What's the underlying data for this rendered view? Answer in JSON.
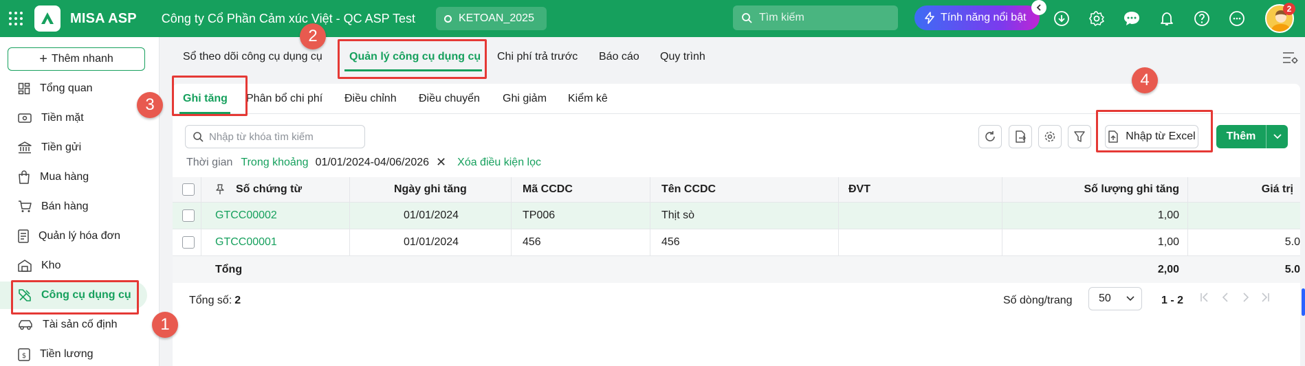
{
  "topbar": {
    "brand": "MISA ASP",
    "company": "Công ty Cổ Phần Cảm xúc Việt - QC ASP Test",
    "db_name": "KETOAN_2025",
    "search_placeholder": "Tìm kiếm",
    "feature_label": "Tính năng nổi bật",
    "notification_count": "2",
    "colors": {
      "brand_green": "#16a05d",
      "feature_gradient_start": "#3d6cf5",
      "feature_gradient_end": "#c026d3"
    }
  },
  "sidebar": {
    "quick_add": "Thêm nhanh",
    "items": [
      {
        "label": "Tổng quan",
        "icon": "dashboard-icon"
      },
      {
        "label": "Tiền mặt",
        "icon": "cash-icon"
      },
      {
        "label": "Tiền gửi",
        "icon": "bank-icon"
      },
      {
        "label": "Mua hàng",
        "icon": "shopping-bag-icon"
      },
      {
        "label": "Bán hàng",
        "icon": "cart-icon"
      },
      {
        "label": "Quản lý hóa đơn",
        "icon": "invoice-icon"
      },
      {
        "label": "Kho",
        "icon": "warehouse-icon"
      },
      {
        "label": "Công cụ dụng cụ",
        "icon": "tools-icon",
        "active": true
      },
      {
        "label": "Tài sản cố định",
        "icon": "car-icon"
      },
      {
        "label": "Tiền lương",
        "icon": "payroll-icon"
      }
    ]
  },
  "module_tabs": [
    {
      "label": "Sổ theo dõi công cụ dụng cụ"
    },
    {
      "label": "Quản lý công cụ dụng cụ",
      "active": true
    },
    {
      "label": "Chi phí trả trước"
    },
    {
      "label": "Báo cáo"
    },
    {
      "label": "Quy trình"
    }
  ],
  "sub_tabs": [
    {
      "label": "Ghi tăng",
      "active": true
    },
    {
      "label": "Phân bổ chi phí"
    },
    {
      "label": "Điều chỉnh"
    },
    {
      "label": "Điều chuyển"
    },
    {
      "label": "Ghi giảm"
    },
    {
      "label": "Kiểm kê"
    }
  ],
  "toolbar": {
    "search_placeholder": "Nhập từ khóa tìm kiếm",
    "import_excel": "Nhập từ Excel",
    "add": "Thêm"
  },
  "filter": {
    "label": "Thời gian",
    "mode": "Trong khoảng",
    "range": "01/01/2024-04/06/2026",
    "clear": "Xóa điều kiện lọc"
  },
  "table": {
    "columns": [
      "Số chứng từ",
      "Ngày ghi tăng",
      "Mã CCDC",
      "Tên CCDC",
      "ĐVT",
      "Số lượng ghi tăng",
      "Giá trị"
    ],
    "rows": [
      {
        "doc_no": "GTCC00002",
        "date": "01/01/2024",
        "code": "TP006",
        "name": "Thịt sò",
        "unit": "",
        "qty": "1,00",
        "value": ""
      },
      {
        "doc_no": "GTCC00001",
        "date": "01/01/2024",
        "code": "456",
        "name": "456",
        "unit": "",
        "qty": "1,00",
        "value": "5.0"
      }
    ],
    "total": {
      "label": "Tổng",
      "qty": "2,00",
      "value": "5.0"
    }
  },
  "footer": {
    "total_label": "Tổng số:",
    "total_value": "2",
    "rows_per_page_label": "Số dòng/trang",
    "rows_per_page": "50",
    "range": "1 - 2"
  },
  "annotations": [
    "1",
    "2",
    "3",
    "4"
  ]
}
